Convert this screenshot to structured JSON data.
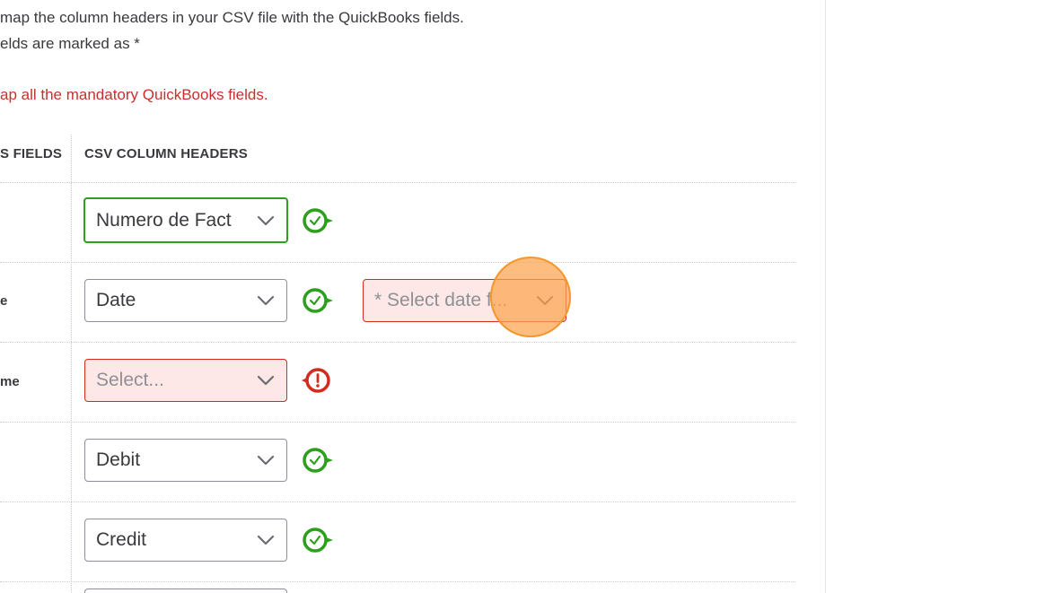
{
  "intro": {
    "line1": "map the column headers in your CSV file with the QuickBooks fields.",
    "line2": "elds are marked as *",
    "error": "ap all the mandatory QuickBooks fields."
  },
  "table": {
    "headers": {
      "quickbooks": "S FIELDS",
      "csv": "CSV COLUMN HEADERS"
    },
    "rows": [
      {
        "label": "",
        "selected": "Numero de Fact",
        "state": "focused",
        "status": "ok"
      },
      {
        "label": "e",
        "selected": "Date",
        "state": "normal",
        "status": "ok",
        "format_placeholder": "* Select date f..."
      },
      {
        "label": "me",
        "selected": "Select...",
        "state": "error",
        "status": "error"
      },
      {
        "label": "",
        "selected": "Debit",
        "state": "normal",
        "status": "ok"
      },
      {
        "label": "",
        "selected": "Credit",
        "state": "normal",
        "status": "ok"
      }
    ]
  },
  "colors": {
    "ok": "#2ca01c",
    "error": "#d52b1e",
    "error_bg": "#fde8e7",
    "error_text": "#c9302c",
    "cursor": "#f4962a"
  },
  "icons": {
    "chevron": "chevron-down-icon",
    "ok": "check-circle-icon",
    "error": "exclamation-circle-icon"
  }
}
